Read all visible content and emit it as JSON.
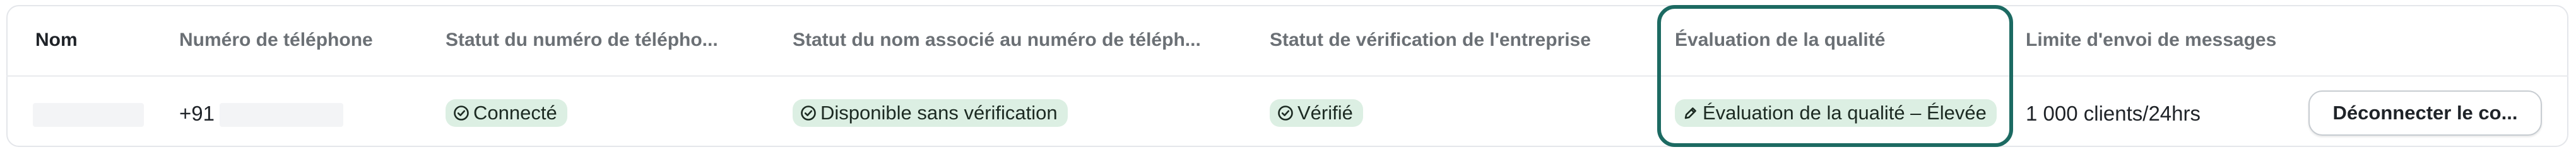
{
  "table": {
    "headers": {
      "name": "Nom",
      "phone": "Numéro de téléphone",
      "number_status": "Statut du numéro de télépho...",
      "name_status": "Statut du nom associé au numéro de téléph...",
      "business_verification": "Statut de vérification de l'entreprise",
      "quality_rating": "Évaluation de la qualité",
      "messaging_limit": "Limite d'envoi de messages"
    },
    "row": {
      "phone_prefix": "+91",
      "number_status": "Connecté",
      "name_status": "Disponible sans vérification",
      "business_verification": "Vérifié",
      "quality_rating": "Évaluation de la qualité – Élevée",
      "messaging_limit": "1 000 clients/24hrs",
      "disconnect_label": "Déconnecter le co..."
    }
  },
  "icons": {
    "status_check": "check-circle-icon",
    "quality": "pencil-icon"
  },
  "colors": {
    "badge_background": "#dcefe3",
    "highlight_border": "#1c6a62"
  }
}
